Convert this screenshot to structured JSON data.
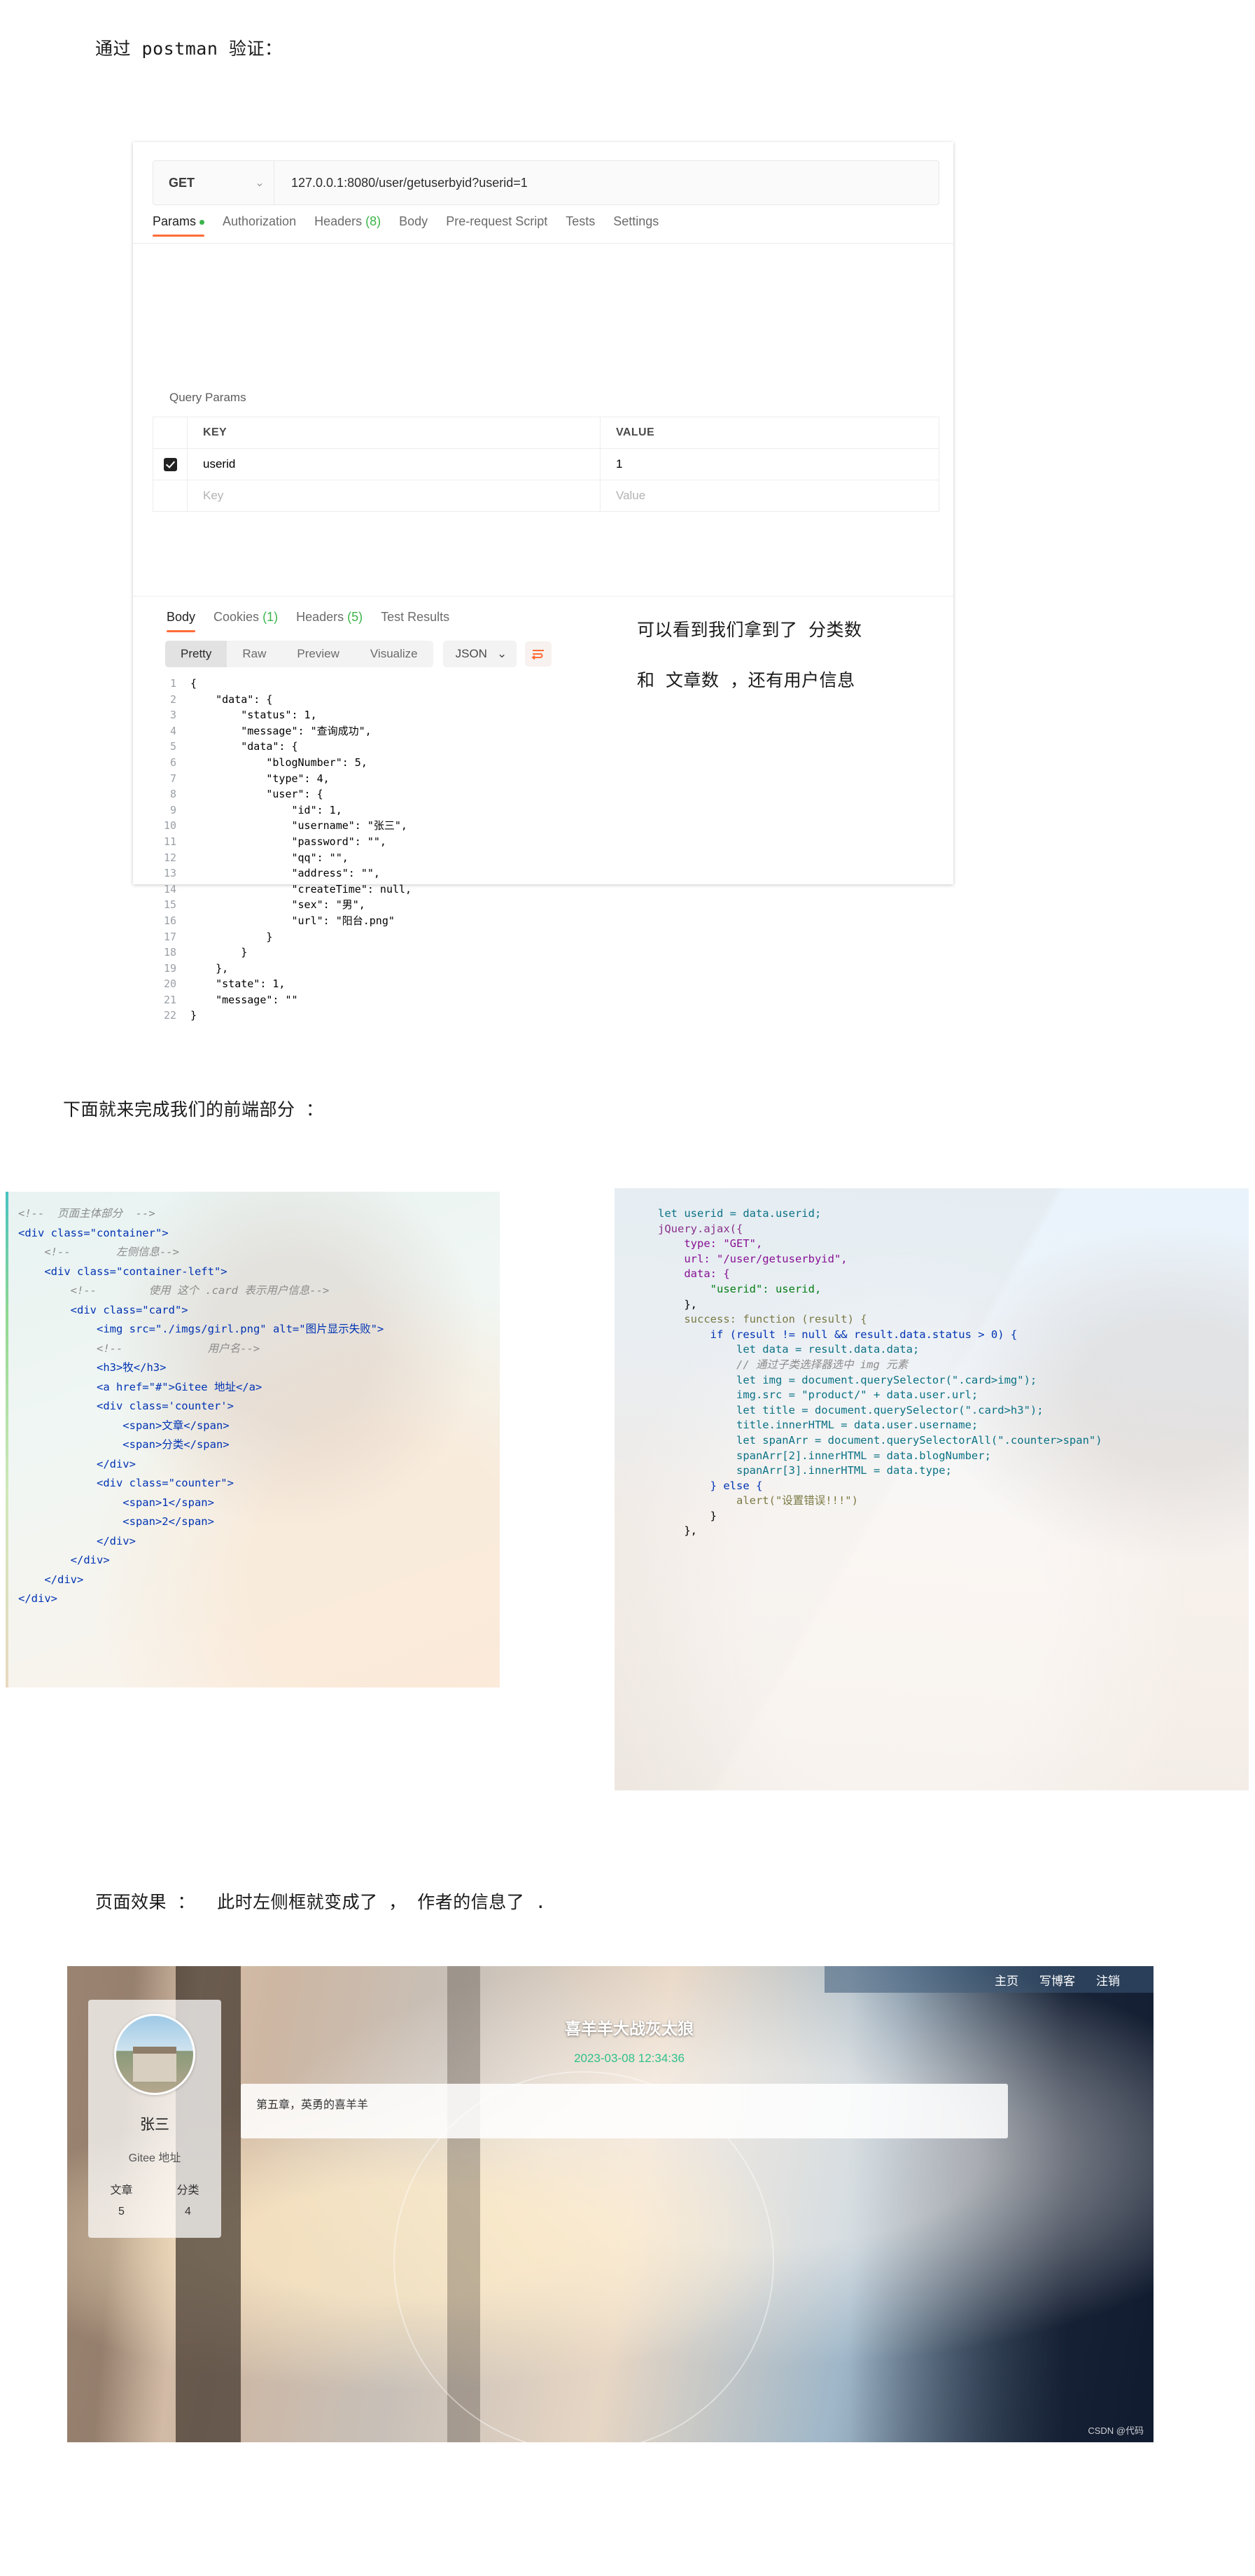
{
  "narration": {
    "line1": "通过 postman 验证：",
    "line2": "下面就来完成我们的前端部分 ：",
    "line3": "页面效果 ：  此时左侧框就变成了 ， 作者的信息了 .",
    "annotation1": "可以看到我们拿到了 分类数",
    "annotation2": "和 文章数 ，还有用户信息"
  },
  "postman": {
    "method": "GET",
    "url": "127.0.0.1:8080/user/getuserbyid?userid=1",
    "request_tabs": [
      {
        "label": "Params",
        "dot": true
      },
      {
        "label": "Authorization"
      },
      {
        "label": "Headers",
        "count": "(8)"
      },
      {
        "label": "Body"
      },
      {
        "label": "Pre-request Script"
      },
      {
        "label": "Tests"
      },
      {
        "label": "Settings"
      }
    ],
    "query_params_label": "Query Params",
    "table_headers": {
      "key": "KEY",
      "value": "VALUE"
    },
    "rows": [
      {
        "checked": true,
        "key": "userid",
        "value": "1"
      },
      {
        "checked": false,
        "key": "Key",
        "value": "Value",
        "placeholder": true
      }
    ],
    "response_tabs": [
      {
        "label": "Body"
      },
      {
        "label": "Cookies",
        "count": "(1)"
      },
      {
        "label": "Headers",
        "count": "(5)"
      },
      {
        "label": "Test Results"
      }
    ],
    "format_buttons": [
      "Pretty",
      "Raw",
      "Preview",
      "Visualize"
    ],
    "format_active": "Pretty",
    "content_type": "JSON",
    "json_lines": [
      {
        "n": 1,
        "text": "{"
      },
      {
        "n": 2,
        "text": "    \"data\": {"
      },
      {
        "n": 3,
        "text": "        \"status\": 1,"
      },
      {
        "n": 4,
        "text": "        \"message\": \"查询成功\","
      },
      {
        "n": 5,
        "text": "        \"data\": {"
      },
      {
        "n": 6,
        "text": "            \"blogNumber\": 5,"
      },
      {
        "n": 7,
        "text": "            \"type\": 4,"
      },
      {
        "n": 8,
        "text": "            \"user\": {"
      },
      {
        "n": 9,
        "text": "                \"id\": 1,"
      },
      {
        "n": 10,
        "text": "                \"username\": \"张三\","
      },
      {
        "n": 11,
        "text": "                \"password\": \"\","
      },
      {
        "n": 12,
        "text": "                \"qq\": \"\","
      },
      {
        "n": 13,
        "text": "                \"address\": \"\","
      },
      {
        "n": 14,
        "text": "                \"createTime\": null,"
      },
      {
        "n": 15,
        "text": "                \"sex\": \"男\","
      },
      {
        "n": 16,
        "text": "                \"url\": \"阳台.png\""
      },
      {
        "n": 17,
        "text": "            }"
      },
      {
        "n": 18,
        "text": "        }"
      },
      {
        "n": 19,
        "text": "    },"
      },
      {
        "n": 20,
        "text": "    \"state\": 1,"
      },
      {
        "n": 21,
        "text": "    \"message\": \"\""
      },
      {
        "n": 22,
        "text": "}"
      }
    ]
  },
  "html_code": [
    "<!--  页面主体部分  -->",
    "<div class=\"container\">",
    "    <!--       左侧信息-->",
    "",
    "    <div class=\"container-left\">",
    "",
    "        <!--        使用 这个 .card 表示用户信息-->",
    "        <div class=\"card\">",
    "            <img src=\"./imgs/girl.png\" alt=\"图片显示失败\">",
    "            <!--             用户名-->",
    "            <h3>牧</h3>",
    "            <a href=\"#\">Gitee 地址</a>",
    "            <div class='counter'>",
    "                <span>文章</span>",
    "                <span>分类</span>",
    "            </div>",
    "            <div class=\"counter\">",
    "                <span>1</span>",
    "                <span>2</span>",
    "            </div>",
    "        </div>",
    "    </div>",
    "</div>"
  ],
  "js_code": [
    "let userid = data.userid;",
    "",
    "jQuery.ajax({",
    "    type: \"GET\",",
    "    url: \"/user/getuserbyid\",",
    "    data: {",
    "        \"userid\": userid,",
    "    },",
    "    success: function (result) {",
    "        if (result != null && result.data.status > 0) {",
    "            let data = result.data.data;",
    "",
    "",
    "            // 通过子类选择器选中 img 元素",
    "",
    "            let img = document.querySelector(\".card>img\");",
    "",
    "            img.src = \"product/\" + data.user.url;",
    "",
    "            let title = document.querySelector(\".card>h3\");",
    "",
    "            title.innerHTML = data.user.username;",
    "",
    "            let spanArr = document.querySelectorAll(\".counter>span\")",
    "",
    "            spanArr[2].innerHTML = data.blogNumber;",
    "",
    "            spanArr[3].innerHTML = data.type;",
    "",
    "",
    "        } else {",
    "            alert(\"设置错误!!!\")",
    "        }",
    "    },"
  ],
  "preview": {
    "nav": [
      "主页",
      "写博客",
      "注销"
    ],
    "author": {
      "name": "张三",
      "gitee_link": "Gitee 地址",
      "labels": [
        "文章",
        "分类"
      ],
      "values": [
        "5",
        "4"
      ]
    },
    "post": {
      "title": "喜羊羊大战灰太狼",
      "date": "2023-03-08 12:34:36",
      "content": "第五章，英勇的喜羊羊"
    },
    "watermark": "CSDN @代码"
  }
}
